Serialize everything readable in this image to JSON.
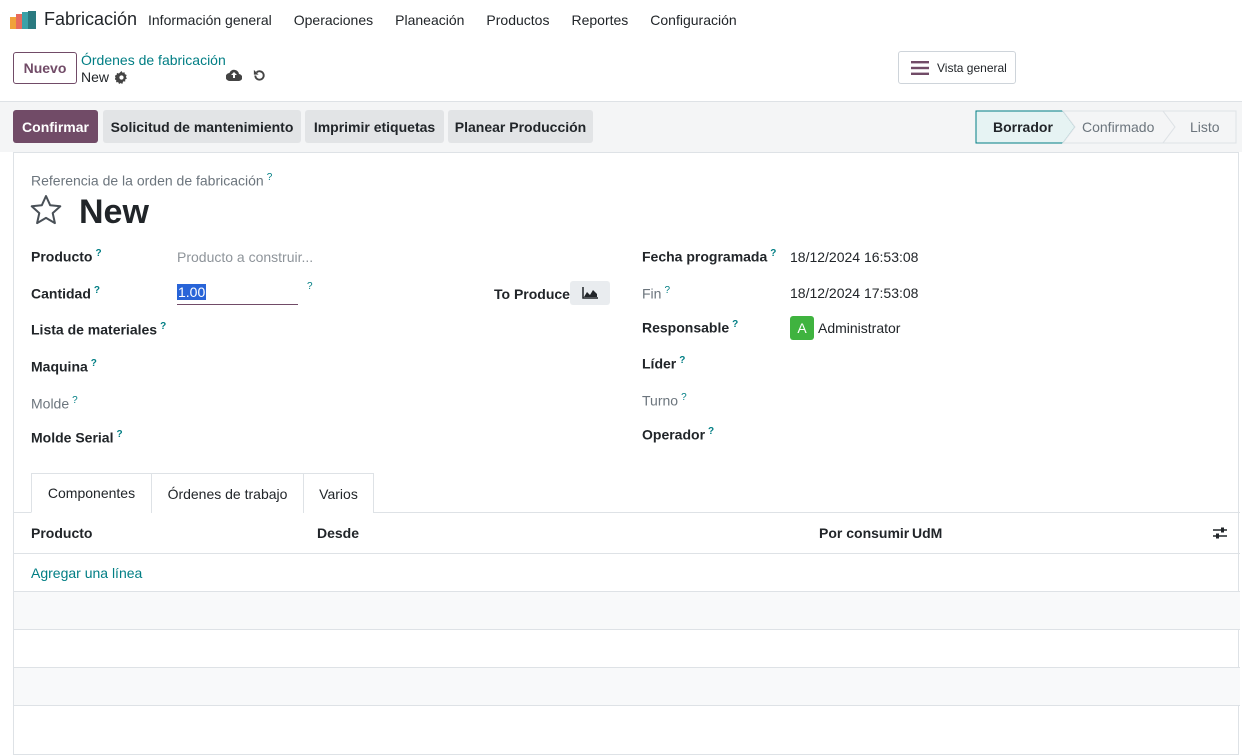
{
  "navbar": {
    "app_name": "Fabricación",
    "menu": [
      "Información general",
      "Operaciones",
      "Planeación",
      "Productos",
      "Reportes",
      "Configuración"
    ]
  },
  "control": {
    "new_button": "Nuevo",
    "breadcrumb": "Órdenes de fabricación",
    "record_name": "New",
    "overview_button": "Vista general"
  },
  "statusbar": {
    "actions": [
      "Confirmar",
      "Solicitud de mantenimiento",
      "Imprimir etiquetas",
      "Planear Producción"
    ],
    "stages": [
      "Borrador",
      "Confirmado",
      "Listo"
    ],
    "active_stage": "Borrador"
  },
  "form": {
    "ref_label": "Referencia de la orden de fabricación",
    "title": "New",
    "help_mark": "?",
    "left": {
      "producto_label": "Producto",
      "producto_placeholder": "Producto a construir...",
      "cantidad_label": "Cantidad",
      "cantidad_value": "1.00",
      "to_produce_label": "To Produce",
      "lista_label": "Lista de materiales",
      "maquina_label": "Maquina",
      "molde_label": "Molde",
      "molde_serial_label": "Molde Serial"
    },
    "right": {
      "fecha_label": "Fecha programada",
      "fecha_value": "18/12/2024 16:53:08",
      "fin_label": "Fin",
      "fin_value": "18/12/2024 17:53:08",
      "responsable_label": "Responsable",
      "responsable_initial": "A",
      "responsable_value": "Administrator",
      "lider_label": "Líder",
      "turno_label": "Turno",
      "operador_label": "Operador"
    }
  },
  "tabs": [
    "Componentes",
    "Órdenes de trabajo",
    "Varios"
  ],
  "list": {
    "columns": [
      "Producto",
      "Desde",
      "Por consumir",
      "UdM"
    ],
    "add_line": "Agregar una línea"
  },
  "colors": {
    "primary": "#714b67",
    "link": "#017e84",
    "avatar": "#3fb33f"
  },
  "icons": [
    "app-logo-icon",
    "gear-icon",
    "cloud-upload-icon",
    "undo-icon",
    "menu-lines-icon",
    "star-icon",
    "area-chart-icon",
    "settings-sliders-icon"
  ]
}
